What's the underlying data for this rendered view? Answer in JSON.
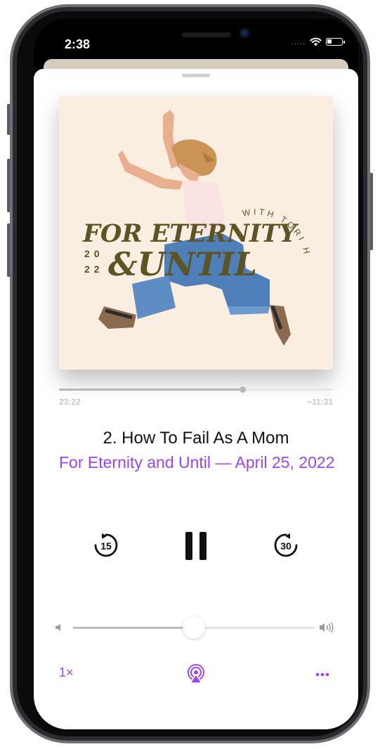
{
  "status_bar": {
    "time": "2:38",
    "signal": "....."
  },
  "artwork": {
    "line1": "FOR ETERNITY",
    "line2": "&UNTIL",
    "byline": "WITH TORI HEIN",
    "year_top": "20",
    "year_bottom": "22",
    "background_color": "#f9eee0",
    "text_color": "#5c5423"
  },
  "playback": {
    "elapsed": "23:22",
    "remaining": "−11:31",
    "progress_fraction": 0.67
  },
  "episode": {
    "title": "2. How To Fail As A Mom",
    "subtitle": "For Eternity and Until — April 25, 2022"
  },
  "controls": {
    "skip_back_seconds": "15",
    "skip_forward_seconds": "30",
    "state": "playing"
  },
  "volume": {
    "level_fraction": 0.5
  },
  "bottom_bar": {
    "speed": "1×"
  },
  "colors": {
    "accent": "#9b45f2",
    "text": "#111111",
    "muted": "#c8c8cb"
  }
}
